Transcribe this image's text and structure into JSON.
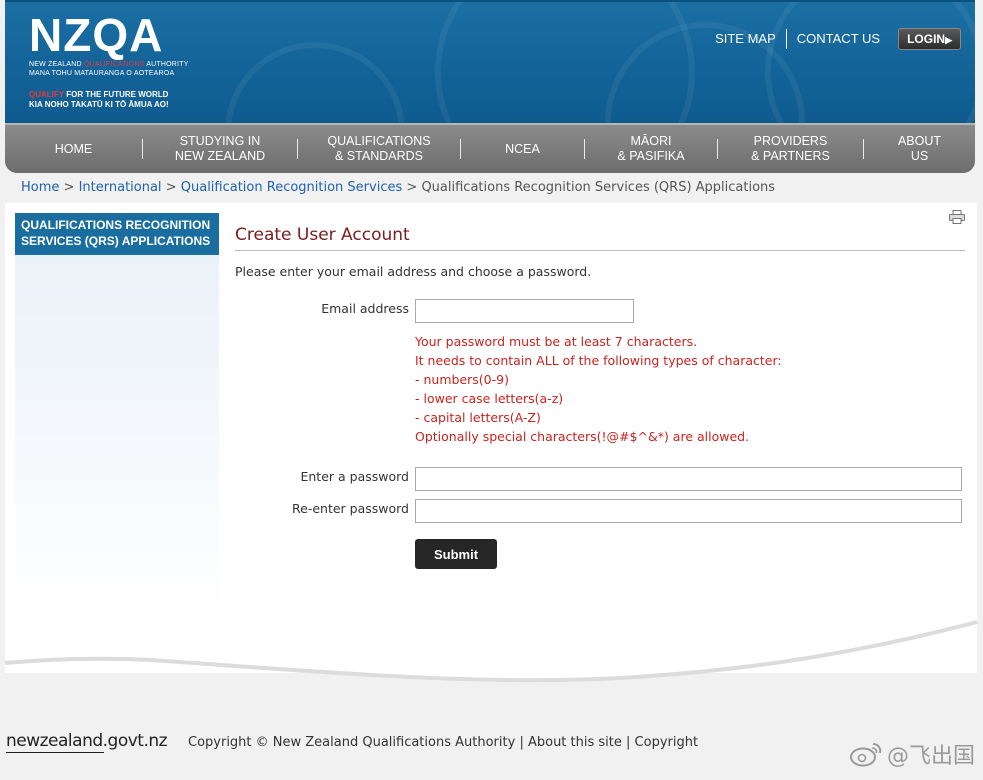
{
  "header": {
    "logo_text": "NZQA",
    "logo_line1_a": "NEW ZEALAND",
    "logo_line1_b": "QUALIFICATIONS",
    "logo_line1_c": "AUTHORITY",
    "logo_line2": "MANA TOHU MATAURANGA O AOTEAROA",
    "tagline_a": "QUALIFY",
    "tagline_b": "FOR THE FUTURE WORLD",
    "tagline2": "KIA NOHO TAKATŪ KI TŌ ĀMUA AO!",
    "site_map": "SITE MAP",
    "contact_us": "CONTACT US",
    "login": "LOGIN"
  },
  "nav": {
    "items": [
      {
        "label": "HOME"
      },
      {
        "label": "STUDYING IN\nNEW ZEALAND"
      },
      {
        "label": "QUALIFICATIONS\n& STANDARDS"
      },
      {
        "label": "NCEA"
      },
      {
        "label": "MĀORI\n& PASIFIKA"
      },
      {
        "label": "PROVIDERS\n& PARTNERS"
      },
      {
        "label": "ABOUT\nUS"
      }
    ]
  },
  "breadcrumb": {
    "home": "Home",
    "international": "International",
    "qrs": "Qualification Recognition Services",
    "current": "Qualifications Recognition Services (QRS) Applications",
    "sep": ">"
  },
  "sidebar": {
    "heading": "QUALIFICATIONS RECOGNITION SERVICES (QRS) APPLICATIONS"
  },
  "form": {
    "title": "Create User Account",
    "intro": "Please enter your email address and choose a password.",
    "email_label": "Email address",
    "email_value": "",
    "rules": [
      "Your password must be at least 7 characters.",
      "It needs to contain ALL of the following types of character:",
      "- numbers(0-9)",
      "- lower case letters(a-z)",
      "- capital letters(A-Z)",
      "Optionally special characters(!@#$^&*) are allowed."
    ],
    "password_label": "Enter a password",
    "password_value": "",
    "reenter_label": "Re-enter password",
    "reenter_value": "",
    "submit_label": "Submit"
  },
  "footer": {
    "govt_logo": "newzealand.govt.nz",
    "copyright": "Copyright © New Zealand Qualifications Authority",
    "about": "About this site",
    "copyright_link": "Copyright",
    "sep": "|"
  },
  "watermark": {
    "text": "@飞出国"
  },
  "colors": {
    "header_blue": "#14649a",
    "nav_gray": "#7a7a7a",
    "link_blue": "#1f62ad",
    "title_maroon": "#7a1c1c",
    "rule_red": "#c8241f",
    "sidebar_blue": "#1a6e9f"
  }
}
